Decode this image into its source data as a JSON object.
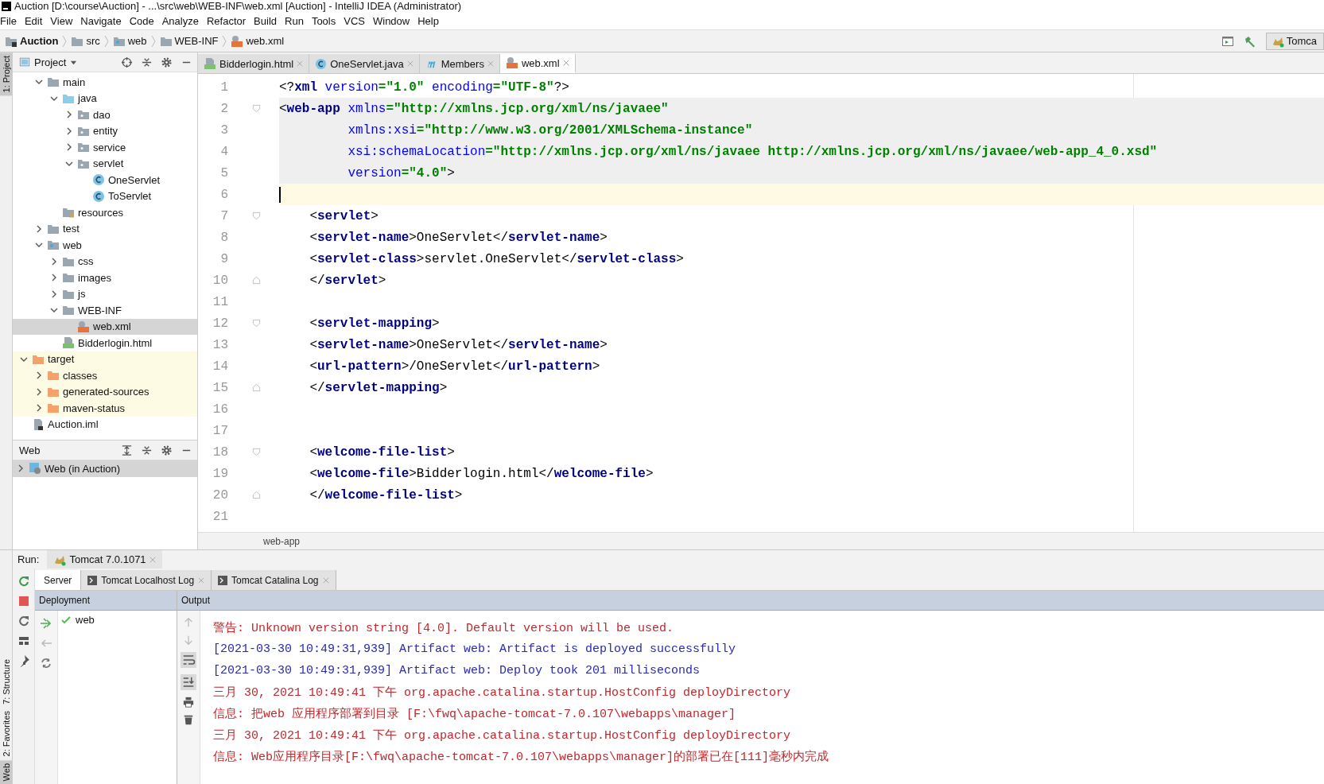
{
  "window": {
    "title": "Auction [D:\\course\\Auction] - ...\\src\\web\\WEB-INF\\web.xml [Auction] - IntelliJ IDEA (Administrator)"
  },
  "menu": [
    "File",
    "Edit",
    "View",
    "Navigate",
    "Code",
    "Analyze",
    "Refactor",
    "Build",
    "Run",
    "Tools",
    "VCS",
    "Window",
    "Help"
  ],
  "breadcrumbs": [
    {
      "label": "Auction",
      "kind": "module"
    },
    {
      "label": "src",
      "kind": "folder"
    },
    {
      "label": "web",
      "kind": "web-folder"
    },
    {
      "label": "WEB-INF",
      "kind": "folder"
    },
    {
      "label": "web.xml",
      "kind": "xml-file"
    }
  ],
  "run_config": {
    "label": "Tomca"
  },
  "side_tabs_top": [
    {
      "label": "1: Project",
      "selected": true
    }
  ],
  "side_tabs_bottom": [
    {
      "label": "7: Structure",
      "selected": false
    },
    {
      "label": "2: Favorites",
      "selected": false
    },
    {
      "label": "Web",
      "selected": true
    }
  ],
  "project": {
    "title": "Project",
    "tree_nested": [
      {
        "label": "main",
        "kind": "folder",
        "expanded": true,
        "selected": false,
        "children": [
          {
            "label": "java",
            "kind": "source-folder",
            "expanded": true,
            "selected": false,
            "children": [
              {
                "label": "dao",
                "kind": "package",
                "expanded": false,
                "selected": false
              },
              {
                "label": "entity",
                "kind": "package",
                "expanded": false,
                "selected": false
              },
              {
                "label": "service",
                "kind": "package",
                "expanded": false,
                "selected": false
              },
              {
                "label": "servlet",
                "kind": "package",
                "expanded": true,
                "selected": false,
                "children": [
                  {
                    "label": "OneServlet",
                    "kind": "class",
                    "selected": false
                  },
                  {
                    "label": "ToServlet",
                    "kind": "class",
                    "selected": false
                  }
                ]
              }
            ]
          },
          {
            "label": "resources",
            "kind": "resources-folder",
            "selected": false
          }
        ]
      },
      {
        "label": "test",
        "kind": "folder",
        "expanded": false,
        "selected": false
      },
      {
        "label": "web",
        "kind": "web-folder",
        "expanded": true,
        "selected": false,
        "children": [
          {
            "label": "css",
            "kind": "folder",
            "expanded": false,
            "selected": false
          },
          {
            "label": "images",
            "kind": "folder",
            "expanded": false,
            "selected": false
          },
          {
            "label": "js",
            "kind": "folder",
            "expanded": false,
            "selected": false
          },
          {
            "label": "WEB-INF",
            "kind": "folder",
            "expanded": true,
            "selected": false,
            "children": [
              {
                "label": "web.xml",
                "kind": "xml-file",
                "selected": true
              }
            ]
          },
          {
            "label": "Bidderlogin.html",
            "kind": "html-file",
            "selected": false
          }
        ]
      }
    ],
    "tree_root": [
      {
        "label": "target",
        "kind": "excluded-folder",
        "expanded": true,
        "selected": false,
        "children": [
          {
            "label": "classes",
            "kind": "excluded-folder",
            "expanded": false,
            "selected": false
          },
          {
            "label": "generated-sources",
            "kind": "excluded-folder",
            "expanded": false,
            "selected": false
          },
          {
            "label": "maven-status",
            "kind": "excluded-folder",
            "expanded": false,
            "selected": false
          }
        ]
      },
      {
        "label": "Auction.iml",
        "kind": "module-file",
        "selected": false
      }
    ]
  },
  "web_panel": {
    "title": "Web",
    "items": [
      {
        "label": "Web (in Auction)",
        "expanded": false,
        "selected": true
      }
    ]
  },
  "editor_tabs": [
    {
      "label": "Bidderlogin.html",
      "kind": "html-file",
      "selected": false
    },
    {
      "label": "OneServlet.java",
      "kind": "class",
      "selected": false
    },
    {
      "label": "Members",
      "kind": "members",
      "selected": false
    },
    {
      "label": "web.xml",
      "kind": "xml-file",
      "selected": true
    }
  ],
  "code_lines": [
    {
      "number": "1",
      "highlighted": false,
      "current": false,
      "kind": "plain",
      "tokens": [
        {
          "kind": "p",
          "text": "<?"
        },
        {
          "kind": "tag",
          "text": "xml"
        },
        {
          "kind": "attr",
          "text": " version"
        },
        {
          "kind": "value",
          "text": "=\"1.0\""
        },
        {
          "kind": "attr",
          "text": " encoding"
        },
        {
          "kind": "value",
          "text": "=\"UTF-8\""
        },
        {
          "kind": "p",
          "text": "?>"
        }
      ]
    },
    {
      "number": "2",
      "highlighted": true,
      "current": false,
      "kind": "fold-start",
      "tokens": [
        {
          "kind": "p",
          "text": "<"
        },
        {
          "kind": "tag",
          "text": "web-app"
        },
        {
          "kind": "attr",
          "text": " xmlns"
        },
        {
          "kind": "value",
          "text": "=\"http://xmlns.jcp.org/xml/ns/javaee\""
        }
      ]
    },
    {
      "number": "3",
      "highlighted": true,
      "current": false,
      "kind": "plain",
      "tokens": [
        {
          "kind": "attr",
          "text": "         xmlns:xsi"
        },
        {
          "kind": "value",
          "text": "=\"http://www.w3.org/2001/XMLSchema-instance\""
        }
      ]
    },
    {
      "number": "4",
      "highlighted": true,
      "current": false,
      "kind": "plain",
      "tokens": [
        {
          "kind": "attr",
          "text": "         xsi:schemaLocation"
        },
        {
          "kind": "value",
          "text": "=\"http://xmlns.jcp.org/xml/ns/javaee http://xmlns.jcp.org/xml/ns/javaee/web-app_4_0.xsd\""
        }
      ]
    },
    {
      "number": "5",
      "highlighted": true,
      "current": false,
      "kind": "plain",
      "tokens": [
        {
          "kind": "attr",
          "text": "         version"
        },
        {
          "kind": "value",
          "text": "=\"4.0\""
        },
        {
          "kind": "p",
          "text": ">"
        }
      ]
    },
    {
      "number": "6",
      "highlighted": false,
      "current": true,
      "kind": "plain"
    },
    {
      "number": "7",
      "highlighted": false,
      "current": false,
      "kind": "fold-start",
      "tokens": [
        {
          "kind": "p",
          "text": "    <"
        },
        {
          "kind": "tag",
          "text": "servlet"
        },
        {
          "kind": "p",
          "text": ">"
        }
      ]
    },
    {
      "number": "8",
      "highlighted": false,
      "current": false,
      "kind": "plain",
      "tokens": [
        {
          "kind": "p",
          "text": "    <"
        },
        {
          "kind": "tag",
          "text": "servlet-name"
        },
        {
          "kind": "p",
          "text": ">OneServlet</"
        },
        {
          "kind": "tag",
          "text": "servlet-name"
        },
        {
          "kind": "p",
          "text": ">"
        }
      ]
    },
    {
      "number": "9",
      "highlighted": false,
      "current": false,
      "kind": "plain",
      "tokens": [
        {
          "kind": "p",
          "text": "    <"
        },
        {
          "kind": "tag",
          "text": "servlet-class"
        },
        {
          "kind": "p",
          "text": ">servlet.OneServlet</"
        },
        {
          "kind": "tag",
          "text": "servlet-class"
        },
        {
          "kind": "p",
          "text": ">"
        }
      ]
    },
    {
      "number": "10",
      "highlighted": false,
      "current": false,
      "kind": "fold-end",
      "tokens": [
        {
          "kind": "p",
          "text": "    </"
        },
        {
          "kind": "tag",
          "text": "servlet"
        },
        {
          "kind": "p",
          "text": ">"
        }
      ]
    },
    {
      "number": "11",
      "highlighted": false,
      "current": false,
      "kind": "plain"
    },
    {
      "number": "12",
      "highlighted": false,
      "current": false,
      "kind": "fold-start",
      "tokens": [
        {
          "kind": "p",
          "text": "    <"
        },
        {
          "kind": "tag",
          "text": "servlet-mapping"
        },
        {
          "kind": "p",
          "text": ">"
        }
      ]
    },
    {
      "number": "13",
      "highlighted": false,
      "current": false,
      "kind": "plain",
      "tokens": [
        {
          "kind": "p",
          "text": "    <"
        },
        {
          "kind": "tag",
          "text": "servlet-name"
        },
        {
          "kind": "p",
          "text": ">OneServlet</"
        },
        {
          "kind": "tag",
          "text": "servlet-name"
        },
        {
          "kind": "p",
          "text": ">"
        }
      ]
    },
    {
      "number": "14",
      "highlighted": false,
      "current": false,
      "kind": "plain",
      "tokens": [
        {
          "kind": "p",
          "text": "    <"
        },
        {
          "kind": "tag",
          "text": "url-pattern"
        },
        {
          "kind": "p",
          "text": ">/OneServlet</"
        },
        {
          "kind": "tag",
          "text": "url-pattern"
        },
        {
          "kind": "p",
          "text": ">"
        }
      ]
    },
    {
      "number": "15",
      "highlighted": false,
      "current": false,
      "kind": "fold-end",
      "tokens": [
        {
          "kind": "p",
          "text": "    </"
        },
        {
          "kind": "tag",
          "text": "servlet-mapping"
        },
        {
          "kind": "p",
          "text": ">"
        }
      ]
    },
    {
      "number": "16",
      "highlighted": false,
      "current": false,
      "kind": "plain"
    },
    {
      "number": "17",
      "highlighted": false,
      "current": false,
      "kind": "plain"
    },
    {
      "number": "18",
      "highlighted": false,
      "current": false,
      "kind": "fold-start",
      "tokens": [
        {
          "kind": "p",
          "text": "    <"
        },
        {
          "kind": "tag",
          "text": "welcome-file-list"
        },
        {
          "kind": "p",
          "text": ">"
        }
      ]
    },
    {
      "number": "19",
      "highlighted": false,
      "current": false,
      "kind": "plain",
      "tokens": [
        {
          "kind": "p",
          "text": "    <"
        },
        {
          "kind": "tag",
          "text": "welcome-file"
        },
        {
          "kind": "p",
          "text": ">Bidderlogin.html</"
        },
        {
          "kind": "tag",
          "text": "welcome-file"
        },
        {
          "kind": "p",
          "text": ">"
        }
      ]
    },
    {
      "number": "20",
      "highlighted": false,
      "current": false,
      "kind": "fold-end",
      "tokens": [
        {
          "kind": "p",
          "text": "    </"
        },
        {
          "kind": "tag",
          "text": "welcome-file-list"
        },
        {
          "kind": "p",
          "text": ">"
        }
      ]
    },
    {
      "number": "21",
      "highlighted": false,
      "current": false,
      "kind": "plain"
    }
  ],
  "editor_breadcrumb": "web-app",
  "run": {
    "label": "Run:",
    "tabs": [
      {
        "label": "Tomcat 7.0.1071",
        "selected": true
      }
    ],
    "sub_tabs": [
      {
        "label": "Server",
        "selected": true,
        "closable": false
      },
      {
        "label": "Tomcat Localhost Log",
        "selected": false,
        "closable": true
      },
      {
        "label": "Tomcat Catalina Log",
        "selected": false,
        "closable": true
      }
    ],
    "deployment_header": "Deployment",
    "output_header": "Output",
    "deployments": [
      {
        "label": "web"
      }
    ],
    "output": [
      {
        "text": "警告: Unknown version string [4.0]. Default version will be used.",
        "color": "#c0282d"
      },
      {
        "text": "[2021-03-30 10:49:31,939] Artifact web: Artifact is deployed successfully",
        "color": "#2a2ab4"
      },
      {
        "text": "[2021-03-30 10:49:31,939] Artifact web: Deploy took 201 milliseconds",
        "color": "#2a2ab4"
      },
      {
        "text": "三月 30, 2021 10:49:41 下午 org.apache.catalina.startup.HostConfig deployDirectory",
        "color": "#c0282d"
      },
      {
        "text": "信息: 把web 应用程序部署到目录 [F:\\fwq\\apache-tomcat-7.0.107\\webapps\\manager]",
        "color": "#c0282d"
      },
      {
        "text": "三月 30, 2021 10:49:41 下午 org.apache.catalina.startup.HostConfig deployDirectory",
        "color": "#c0282d"
      },
      {
        "text": "信息: Web应用程序目录[F:\\fwq\\apache-tomcat-7.0.107\\webapps\\manager]的部署已在[111]毫秒内完成",
        "color": "#c0282d"
      }
    ]
  }
}
